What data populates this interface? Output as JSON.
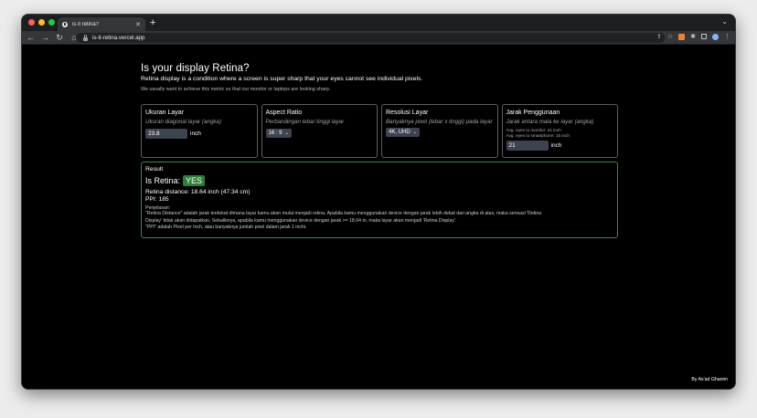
{
  "browser": {
    "tab_title": "is it retina?",
    "new_tab": "+",
    "url": "is-it-retina.vercel.app"
  },
  "page": {
    "title": "Is your display Retina?",
    "lead": "Retina display is a condition where a screen is super sharp that your eyes cannot see individual pixels.",
    "sub": "We usually want to achieve this metric so that our monitor or laptops are looking sharp."
  },
  "cards": {
    "size": {
      "label": "Ukuran Layar",
      "desc": "Ukuran diagonal layar (angka)",
      "value": "23.8",
      "unit": "inch"
    },
    "aspect": {
      "label": "Aspect Ratio",
      "desc": "Perbandingan lebar:tinggi layar",
      "selected": "16 : 9"
    },
    "resolution": {
      "label": "Resolusi Layar",
      "desc": "Banyaknya pixel (lebar x tinggi) pada layar",
      "selected": "4K, UHD"
    },
    "distance": {
      "label": "Jarak Penggunaan",
      "desc": "Jarak antara mata ke layar (angka)",
      "hint1": "Avg. eyes to monitor: 21 inch",
      "hint2": "Avg. eyes to smartphone: 15 inch",
      "value": "21",
      "unit": "inch"
    }
  },
  "result": {
    "label": "Result",
    "is_retina_label": "Is Retina:",
    "is_retina_value": "YES",
    "distance_line": "Retina distance: 18.64 inch (47.34 cm)",
    "ppi_line": "PPI: 185",
    "expl_title": "Penjelasan:",
    "expl1": "\"Retina Distance\" adalah jarak terdekat dimana layar kamu akan mulai menjadi retina. Apabila kamu menggunakan device dengan jarak lebih dekat dari angka di atas, maka sensasi 'Retina",
    "expl2": "Display' tidak akan didapatkan. Sebaliknya, apabila kamu menggunakan device dengan jarak >= 18.64 in, maka layar akan menjadi 'Retina Display'.",
    "expl3": "\"PPI\" adalah Pixel per Inch, atau banyaknya jumlah pixel dalam jarak 1 inchi."
  },
  "footer": {
    "text": "By  As'ad Ghanim"
  },
  "colors": {
    "page_bg": "#000000",
    "result_border": "#3a8a4a",
    "badge_bg": "#2f7d3a"
  }
}
